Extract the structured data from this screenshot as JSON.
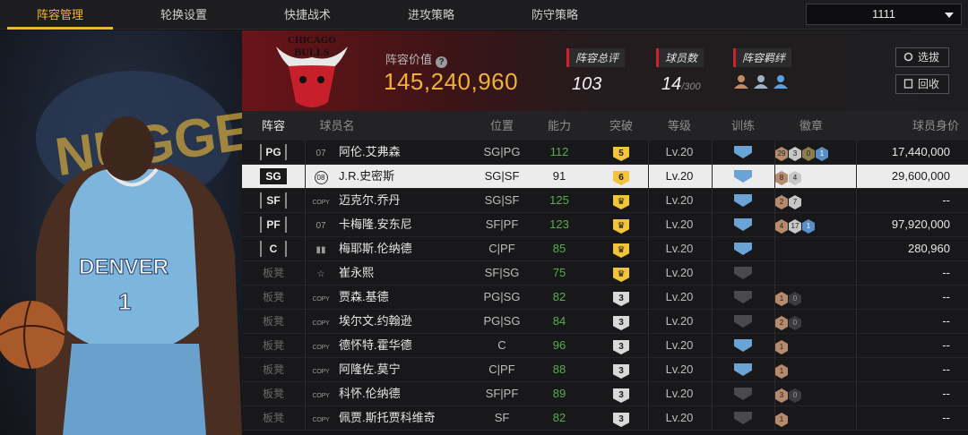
{
  "tabs": [
    {
      "label": "阵容管理",
      "active": true
    },
    {
      "label": "轮换设置",
      "active": false
    },
    {
      "label": "快捷战术",
      "active": false
    },
    {
      "label": "进攻策略",
      "active": false
    },
    {
      "label": "防守策略",
      "active": false
    }
  ],
  "team_select": {
    "value": "1111"
  },
  "header": {
    "value_label": "阵容价值",
    "value": "145,240,960",
    "rating_label": "阵容总评",
    "rating": "103",
    "count_label": "球员数",
    "count": "14",
    "count_max": "/300",
    "bond_label": "阵容羁绊",
    "select_btn": "选拔",
    "recycle_btn": "回收"
  },
  "portrait": {
    "jersey_team": "DENVER",
    "jersey_number": "1",
    "bg_text": "NUGGETS"
  },
  "logo": {
    "text_top": "CHICAGO",
    "text_bottom": "BULLS"
  },
  "columns": {
    "pos": "阵容",
    "name": "球员名",
    "spot": "位置",
    "rating": "能力",
    "break": "突破",
    "level": "等级",
    "train": "训练",
    "badge": "徽章",
    "value": "球员身价"
  },
  "rows": [
    {
      "pos": "PG",
      "bench": false,
      "num": "07",
      "num_style": "plain",
      "name": "阿伦.艾弗森",
      "spot": "SG|PG",
      "rating": "112",
      "break": "5",
      "break_color": "gold",
      "level": "Lv.20",
      "train": "blue",
      "badges": [
        [
          "29",
          "br"
        ],
        [
          "3",
          "sv"
        ],
        [
          "0",
          "gd"
        ],
        [
          "1",
          "bl"
        ]
      ],
      "value": "17,440,000"
    },
    {
      "pos": "SG",
      "bench": false,
      "num": "08",
      "num_style": "circle",
      "name": "J.R.史密斯",
      "spot": "SG|SF",
      "rating": "91",
      "break": "6",
      "break_color": "gold",
      "level": "Lv.20",
      "train": "blue",
      "badges": [
        [
          "8",
          "br"
        ],
        [
          "4",
          "sv"
        ]
      ],
      "value": "29,600,000",
      "selected": true
    },
    {
      "pos": "SF",
      "bench": false,
      "num": "COPY",
      "num_style": "copy",
      "name": "迈克尔.乔丹",
      "spot": "SG|SF",
      "rating": "125",
      "break": "♛",
      "break_color": "gold",
      "level": "Lv.20",
      "train": "blue",
      "badges": [
        [
          "2",
          "br"
        ],
        [
          "7",
          "sv"
        ]
      ],
      "value": "--"
    },
    {
      "pos": "PF",
      "bench": false,
      "num": "07",
      "num_style": "plain",
      "name": "卡梅隆.安东尼",
      "spot": "SF|PF",
      "rating": "123",
      "break": "♛",
      "break_color": "gold",
      "level": "Lv.20",
      "train": "blue",
      "badges": [
        [
          "4",
          "br"
        ],
        [
          "17",
          "sv"
        ],
        [
          "1",
          "bl"
        ]
      ],
      "value": "97,920,000"
    },
    {
      "pos": "C",
      "bench": false,
      "num": "▮▮",
      "num_style": "plain",
      "name": "梅耶斯.伦纳德",
      "spot": "C|PF",
      "rating": "85",
      "break": "♛",
      "break_color": "gold",
      "level": "Lv.20",
      "train": "blue",
      "badges": [],
      "value": "280,960"
    },
    {
      "pos": "板凳",
      "bench": true,
      "num": "☆",
      "num_style": "plain",
      "name": "崔永熙",
      "spot": "SF|SG",
      "rating": "75",
      "break": "♛",
      "break_color": "gold",
      "level": "Lv.20",
      "train": "dim",
      "badges": [],
      "value": "--"
    },
    {
      "pos": "板凳",
      "bench": true,
      "num": "COPY",
      "num_style": "copy",
      "name": "贾森.基德",
      "spot": "PG|SG",
      "rating": "82",
      "break": "3",
      "break_color": "gray",
      "level": "Lv.20",
      "train": "dim",
      "badges": [
        [
          "1",
          "br"
        ],
        [
          "0",
          "dk"
        ]
      ],
      "value": "--"
    },
    {
      "pos": "板凳",
      "bench": true,
      "num": "COPY",
      "num_style": "copy",
      "name": "埃尔文.约翰逊",
      "spot": "PG|SG",
      "rating": "84",
      "break": "3",
      "break_color": "gray",
      "level": "Lv.20",
      "train": "dim",
      "badges": [
        [
          "2",
          "br"
        ],
        [
          "0",
          "dk"
        ]
      ],
      "value": "--"
    },
    {
      "pos": "板凳",
      "bench": true,
      "num": "COPY",
      "num_style": "copy",
      "name": "德怀特.霍华德",
      "spot": "C",
      "rating": "96",
      "break": "3",
      "break_color": "gray",
      "level": "Lv.20",
      "train": "blue",
      "badges": [
        [
          "1",
          "br"
        ]
      ],
      "value": "--"
    },
    {
      "pos": "板凳",
      "bench": true,
      "num": "COPY",
      "num_style": "copy",
      "name": "阿隆佐.莫宁",
      "spot": "C|PF",
      "rating": "88",
      "break": "3",
      "break_color": "gray",
      "level": "Lv.20",
      "train": "blue",
      "badges": [
        [
          "1",
          "br"
        ]
      ],
      "value": "--"
    },
    {
      "pos": "板凳",
      "bench": true,
      "num": "COPY",
      "num_style": "copy",
      "name": "科怀.伦纳德",
      "spot": "SF|PF",
      "rating": "89",
      "break": "3",
      "break_color": "gray",
      "level": "Lv.20",
      "train": "dim",
      "badges": [
        [
          "3",
          "br"
        ],
        [
          "0",
          "dk"
        ]
      ],
      "value": "--"
    },
    {
      "pos": "板凳",
      "bench": true,
      "num": "COPY",
      "num_style": "copy",
      "name": "佩贾.斯托贾科维奇",
      "spot": "SF",
      "rating": "82",
      "break": "3",
      "break_color": "gray",
      "level": "Lv.20",
      "train": "dim",
      "badges": [
        [
          "1",
          "br"
        ]
      ],
      "value": "--"
    }
  ]
}
